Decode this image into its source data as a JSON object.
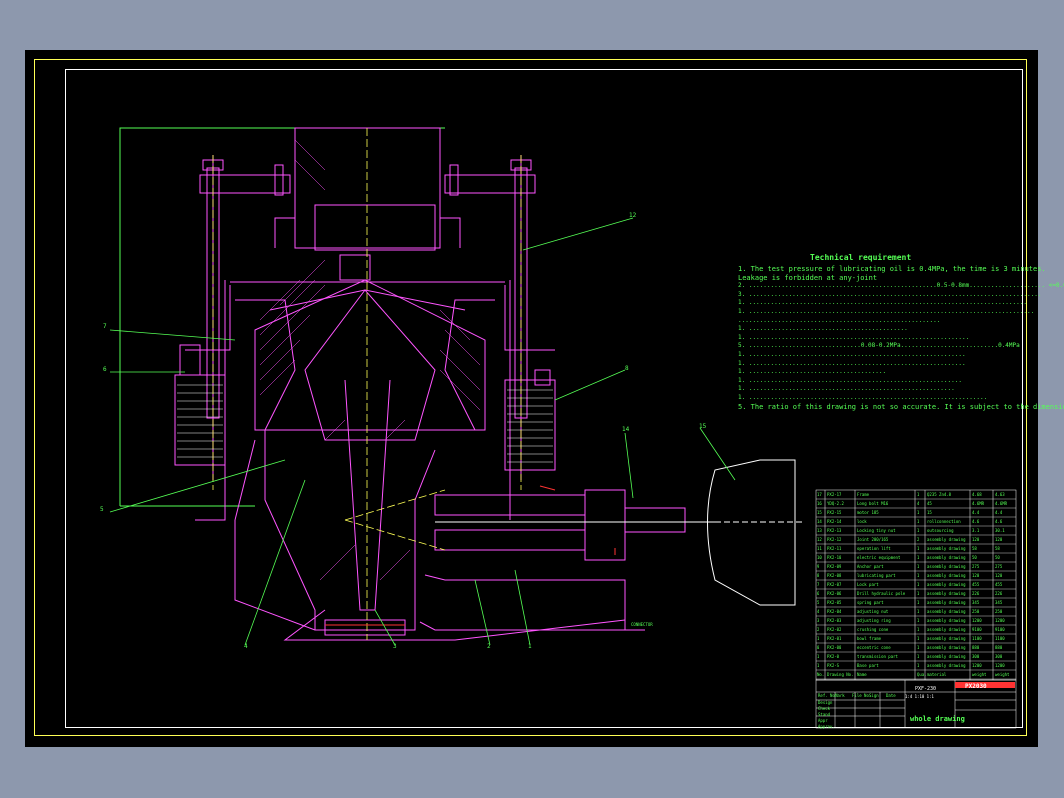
{
  "drawing": {
    "title_block": {
      "drawing_name": "whole drawing",
      "drawing_no": "PX2030",
      "scale_text": "PXF-230",
      "scale_sub": "1:4  1:10  1:1",
      "labels": [
        "Ref. No.",
        "Mark",
        "File No.",
        "Sign",
        "Date",
        "Design",
        "Check",
        "Stand",
        "Appr",
        "Approv."
      ]
    },
    "technical_requirements": {
      "title": "Technical requirement",
      "items": [
        "1. The test pressure of lubricating oil is 0.4MPa, the time is 3 minutes.",
        "   Leakage is forbidden at any-joint",
        "2. ....................................................0.5-0.8mm..................... <=0.03mm",
        "3. .................................................................................",
        "1. .............................................................................",
        "1. ...............................................................................",
        "   ........................................................",
        "1. ............................................",
        "1. .............................................................",
        "5. ...............................0.08-0.2MPa...........................0.4MPa",
        "1. ............................................................",
        "1. ............................................................",
        "1. ......................................",
        "1. ...........................................................",
        "1. .........................................................",
        "1. ..................................................................",
        "5. The ratio of this drawing is not so accurate. It is subject to the dimension"
      ]
    },
    "callouts": [
      "12",
      "7",
      "6",
      "8",
      "14",
      "15",
      "5",
      "4",
      "3",
      "2",
      "1"
    ],
    "outlet_label": "CONNECTOR",
    "bill_of_materials": {
      "rows": [
        {
          "no": "17",
          "code": "PX2-17",
          "name": "Frame",
          "qty": "1",
          "material": "Q235 Zn4.8",
          "w": "4.68",
          "t": "4.63"
        },
        {
          "no": "16",
          "code": "YDQ-2.2",
          "name": "Long bolt M16",
          "qty": "4",
          "material": "45",
          "w": "4.6MR",
          "t": "4.6MR"
        },
        {
          "no": "15",
          "code": "PX2-15",
          "name": "motor 185",
          "qty": "1",
          "material": "15",
          "w": "4.4",
          "t": "4.4"
        },
        {
          "no": "14",
          "code": "PX2-14",
          "name": "lock",
          "qty": "1",
          "material": "rollconnection",
          "w": "4.6",
          "t": "4.6"
        },
        {
          "no": "13",
          "code": "PX2-13",
          "name": "Locking tiny nut",
          "qty": "1",
          "material": "outsourcing",
          "w": "3.1",
          "t": "30.1"
        },
        {
          "no": "12",
          "code": "PX2-12",
          "name": "Joint 200/165",
          "qty": "2",
          "material": "assembly drawing",
          "w": "120",
          "t": "120"
        },
        {
          "no": "11",
          "code": "PX2-11",
          "name": "operation lift",
          "qty": "1",
          "material": "assembly drawing",
          "w": "58",
          "t": "58"
        },
        {
          "no": "10",
          "code": "PX2-10",
          "name": "electric equipment",
          "qty": "1",
          "material": "assembly drawing",
          "w": "50",
          "t": "50"
        },
        {
          "no": "9",
          "code": "PX2-09",
          "name": "Anchor part",
          "qty": "1",
          "material": "assembly drawing",
          "w": "275",
          "t": "275"
        },
        {
          "no": "8",
          "code": "PX2-08",
          "name": "lubricating part",
          "qty": "1",
          "material": "assembly drawing",
          "w": "120",
          "t": "120"
        },
        {
          "no": "7",
          "code": "PX2-07",
          "name": "Lock part",
          "qty": "1",
          "material": "assembly drawing",
          "w": "455",
          "t": "455"
        },
        {
          "no": "6",
          "code": "PX2-06",
          "name": "Drill hydraulic pole",
          "qty": "1",
          "material": "assembly drawing",
          "w": "226",
          "t": "226"
        },
        {
          "no": "5",
          "code": "PX2-05",
          "name": "spring part",
          "qty": "1",
          "material": "assembly drawing",
          "w": "345",
          "t": "345"
        },
        {
          "no": "4",
          "code": "PX2-04",
          "name": "adjusting nut",
          "qty": "1",
          "material": "assembly drawing",
          "w": "250",
          "t": "250"
        },
        {
          "no": "3",
          "code": "PX2-03",
          "name": "adjusting ring",
          "qty": "1",
          "material": "assembly drawing",
          "w": "1200",
          "t": "1200"
        },
        {
          "no": "2",
          "code": "PX2-02",
          "name": "crushing cone",
          "qty": "1",
          "material": "assembly drawing",
          "w": "9100",
          "t": "9100"
        },
        {
          "no": "1",
          "code": "PX2-01",
          "name": "bowl frame",
          "qty": "1",
          "material": "assembly drawing",
          "w": "1100",
          "t": "1100"
        },
        {
          "no": "0",
          "code": "PX2-00",
          "name": "eccentric cone",
          "qty": "1",
          "material": "assembly drawing",
          "w": "880",
          "t": "880"
        },
        {
          "no": "1",
          "code": "PX2-0",
          "name": "transmission part",
          "qty": "1",
          "material": "assembly drawing",
          "w": "300",
          "t": "300"
        },
        {
          "no": "1",
          "code": "PX2-S",
          "name": "Base part",
          "qty": "1",
          "material": "assembly drawing",
          "w": "1200",
          "t": "1200"
        }
      ],
      "header": {
        "no": "No.",
        "code": "Drawing No.",
        "name": "Name",
        "qty": "Qua.",
        "material": "material",
        "w": "weight",
        "t": "weight"
      },
      "note": "PX2030"
    }
  },
  "colors": {
    "background": "#8d98ad",
    "sheet": "#000000",
    "outline": "#ff55ff",
    "leader": "#55ff55",
    "center": "#ffff55",
    "white": "#ffffff",
    "red": "#ff3333"
  }
}
